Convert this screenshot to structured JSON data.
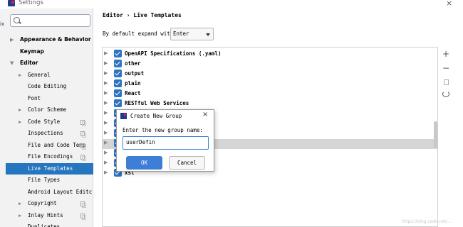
{
  "window": {
    "title": "Settings",
    "edge_text": "ix"
  },
  "sidebar": {
    "search_placeholder": "",
    "items": [
      {
        "label": "Appearance & Behavior",
        "level": 0,
        "arrow": "▶",
        "bold": true,
        "copy": false,
        "selected": false
      },
      {
        "label": "Keymap",
        "level": 0,
        "arrow": "",
        "bold": true,
        "copy": false,
        "selected": false
      },
      {
        "label": "Editor",
        "level": 0,
        "arrow": "▼",
        "bold": true,
        "copy": false,
        "selected": false
      },
      {
        "label": "General",
        "level": 1,
        "arrow": "▶",
        "bold": false,
        "copy": false,
        "selected": false
      },
      {
        "label": "Code Editing",
        "level": 1,
        "arrow": "",
        "bold": false,
        "copy": false,
        "selected": false
      },
      {
        "label": "Font",
        "level": 1,
        "arrow": "",
        "bold": false,
        "copy": false,
        "selected": false
      },
      {
        "label": "Color Scheme",
        "level": 1,
        "arrow": "▶",
        "bold": false,
        "copy": false,
        "selected": false
      },
      {
        "label": "Code Style",
        "level": 1,
        "arrow": "▶",
        "bold": false,
        "copy": true,
        "selected": false
      },
      {
        "label": "Inspections",
        "level": 1,
        "arrow": "",
        "bold": false,
        "copy": true,
        "selected": false
      },
      {
        "label": "File and Code Temp",
        "level": 1,
        "arrow": "",
        "bold": false,
        "copy": true,
        "selected": false
      },
      {
        "label": "File Encodings",
        "level": 1,
        "arrow": "",
        "bold": false,
        "copy": true,
        "selected": false
      },
      {
        "label": "Live Templates",
        "level": 1,
        "arrow": "",
        "bold": false,
        "copy": false,
        "selected": true
      },
      {
        "label": "File Types",
        "level": 1,
        "arrow": "",
        "bold": false,
        "copy": false,
        "selected": false
      },
      {
        "label": "Android Layout Editc",
        "level": 1,
        "arrow": "",
        "bold": false,
        "copy": false,
        "selected": false
      },
      {
        "label": "Copyright",
        "level": 1,
        "arrow": "▶",
        "bold": false,
        "copy": true,
        "selected": false
      },
      {
        "label": "Inlay Hints",
        "level": 1,
        "arrow": "▶",
        "bold": false,
        "copy": true,
        "selected": false
      },
      {
        "label": "Duplicates",
        "level": 1,
        "arrow": "",
        "bold": false,
        "copy": false,
        "selected": false
      }
    ]
  },
  "breadcrumb": {
    "parent": "Editor",
    "separator": "›",
    "current": "Live Templates"
  },
  "expand": {
    "label": "By default expand with",
    "value": "Enter"
  },
  "templates": [
    {
      "label": "OpenAPI Specifications (.yaml)",
      "checked": true
    },
    {
      "label": "other",
      "checked": true
    },
    {
      "label": "output",
      "checked": true
    },
    {
      "label": "plain",
      "checked": true
    },
    {
      "label": "React",
      "checked": true
    },
    {
      "label": "RESTful Web Services",
      "checked": true
    },
    {
      "label": "",
      "checked": true
    },
    {
      "label": "",
      "checked": true
    },
    {
      "label": "",
      "checked": true
    },
    {
      "label": "",
      "checked": true
    },
    {
      "label": "",
      "checked": true
    },
    {
      "label": "",
      "checked": true
    },
    {
      "label": "xsl",
      "checked": true
    }
  ],
  "toolbar": {
    "add": "+",
    "remove": "−"
  },
  "dialog": {
    "title": "Create New Group",
    "prompt": "Enter the new group name:",
    "input_value": "userDefin",
    "ok_label": "OK",
    "cancel_label": "Cancel",
    "close": "×"
  },
  "watermark": "https://blog.csdn.net/..."
}
